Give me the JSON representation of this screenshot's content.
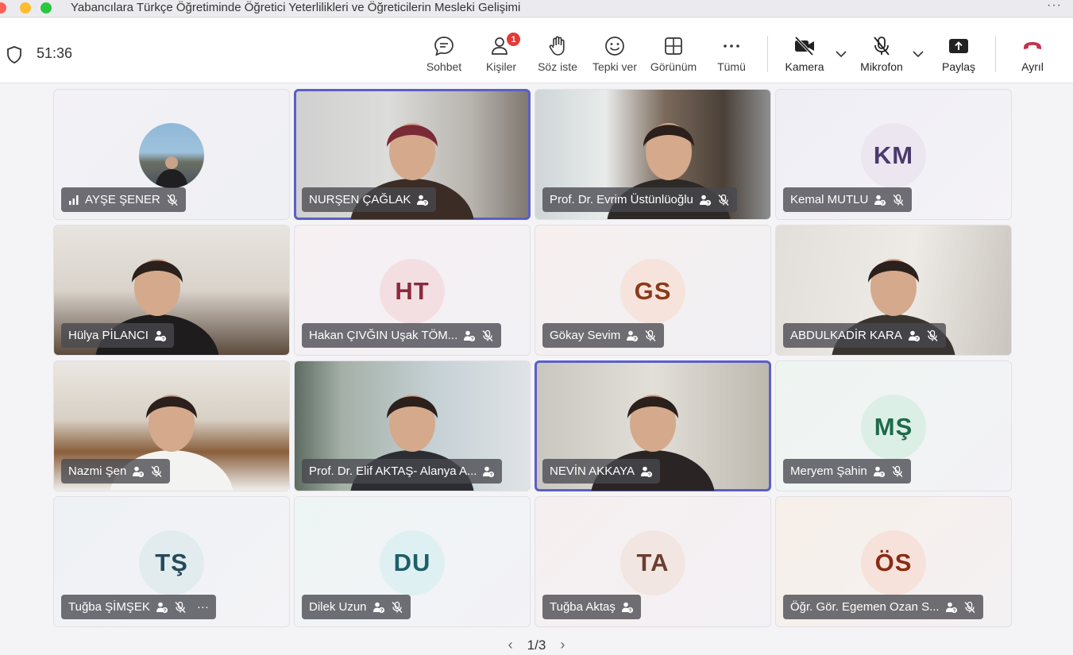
{
  "window": {
    "title": "Yabancılara Türkçe Öğretiminde Öğretici Yeterlilikleri ve Öğreticilerin Mesleki Gelişimi",
    "more_label": "···"
  },
  "meeting": {
    "timer": "51:36"
  },
  "toolbar": {
    "chat": "Sohbet",
    "people": "Kişiler",
    "people_badge": "1",
    "raise_hand": "Söz iste",
    "react": "Tepki ver",
    "view": "Görünüm",
    "more": "Tümü",
    "camera": "Kamera",
    "mic": "Mikrofon",
    "share": "Paylaş",
    "leave": "Ayrıl"
  },
  "participants": [
    {
      "name": "AYŞE ŞENER",
      "type": "photo_avatar",
      "muted": true,
      "signal": true
    },
    {
      "name": "NURŞEN ÇAĞLAK",
      "type": "video",
      "speaking": true
    },
    {
      "name": "Prof. Dr. Evrim Üstünlüoğlu",
      "type": "video",
      "muted": true
    },
    {
      "name": "Kemal MUTLU",
      "type": "initials",
      "initials": "KM",
      "muted": true,
      "avatar_bg": "#ece6f1",
      "avatar_fg": "#4a3a6e"
    },
    {
      "name": "Hülya PİLANCI",
      "type": "video"
    },
    {
      "name": "Hakan ÇIVĞIN Uşak TÖM...",
      "type": "initials",
      "initials": "HT",
      "muted": true,
      "avatar_bg": "#f3dfe2",
      "avatar_fg": "#8a2a3e"
    },
    {
      "name": "Gökay Sevim",
      "type": "initials",
      "initials": "GS",
      "muted": true,
      "avatar_bg": "#f6e4dc",
      "avatar_fg": "#8a3a1a"
    },
    {
      "name": "ABDULKADİR KARA",
      "type": "video",
      "muted": true
    },
    {
      "name": "Nazmi Şen",
      "type": "video",
      "muted": true
    },
    {
      "name": "Prof. Dr. Elif AKTAŞ- Alanya A...",
      "type": "video"
    },
    {
      "name": "NEVİN AKKAYA",
      "type": "video",
      "speaking": true
    },
    {
      "name": "Meryem Şahin",
      "type": "initials",
      "initials": "MŞ",
      "muted": true,
      "avatar_bg": "#dcefe6",
      "avatar_fg": "#1e6a4a"
    },
    {
      "name": "Tuğba ŞİMŞEK",
      "type": "initials",
      "initials": "TŞ",
      "muted": true,
      "more": "···",
      "avatar_bg": "#e2ecef",
      "avatar_fg": "#244a5a"
    },
    {
      "name": "Dilek Uzun",
      "type": "initials",
      "initials": "DU",
      "muted": true,
      "avatar_bg": "#dff0f2",
      "avatar_fg": "#1d5f6a"
    },
    {
      "name": "Tuğba Aktaş",
      "type": "initials",
      "initials": "TA",
      "avatar_bg": "#f2e6e2",
      "avatar_fg": "#6a3e30"
    },
    {
      "name": "Öğr. Gör. Egemen Ozan S...",
      "type": "initials",
      "initials": "ÖS",
      "muted": true,
      "avatar_bg": "#f6e2da",
      "avatar_fg": "#8a2a12"
    }
  ],
  "pager": {
    "label": "1/3",
    "prev": "‹",
    "next": "›"
  },
  "colors": {
    "speaking_outline": "#5b5fc7",
    "leave": "#c4314b",
    "badge": "#e53935"
  }
}
